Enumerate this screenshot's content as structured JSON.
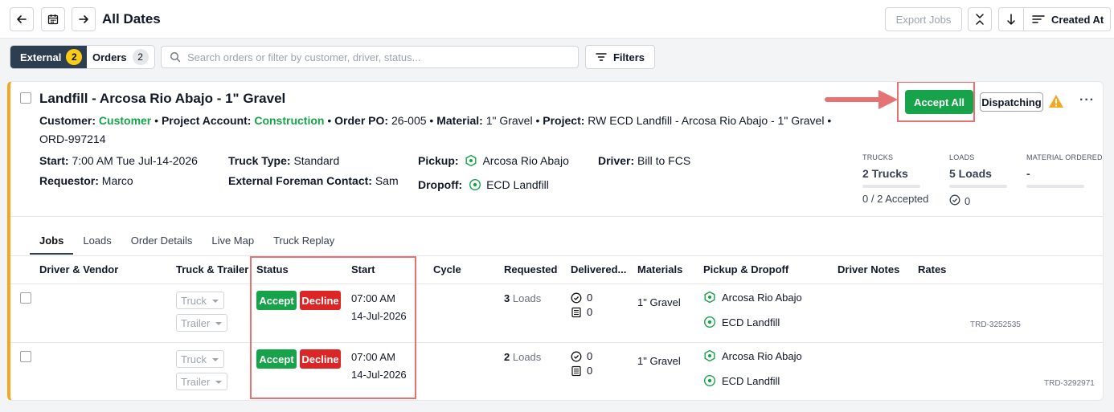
{
  "header": {
    "title": "All Dates",
    "export_label": "Export Jobs",
    "sort_label": "Created At"
  },
  "toolbar": {
    "segments": [
      {
        "label": "External",
        "count": "2"
      },
      {
        "label": "Orders",
        "count": "2"
      }
    ],
    "search_placeholder": "Search orders or filter by customer, driver, status...",
    "filters_label": "Filters"
  },
  "order": {
    "title": "Landfill - Arcosa Rio Abajo - 1\" Gravel",
    "customer_label": "Customer:",
    "customer": "Customer",
    "project_account_label": "Project Account:",
    "project_account": "Construction",
    "po_label": "Order PO:",
    "po": "26-005",
    "material_label": "Material:",
    "material": "1\" Gravel",
    "project_label": "Project:",
    "project": "RW ECD Landfill - Arcosa Rio Abajo - 1\" Gravel",
    "order_id": "ORD-997214",
    "start_label": "Start:",
    "start": "7:00 AM Tue Jul-14-2026",
    "requestor_label": "Requestor:",
    "requestor": "Marco",
    "truck_type_label": "Truck Type:",
    "truck_type": "Standard",
    "foreman_label": "External Foreman Contact:",
    "foreman": "Sam",
    "pickup_label": "Pickup:",
    "pickup": "Arcosa Rio Abajo",
    "dropoff_label": "Dropoff:",
    "dropoff": "ECD Landfill",
    "driver_label": "Driver:",
    "driver": "Bill to FCS",
    "accept_all_label": "Accept All",
    "dispatching_label": "Dispatching",
    "more_label": "···"
  },
  "stats": {
    "trucks_header": "TRUCKS",
    "trucks_value": "2 Trucks",
    "trucks_sub": "0 / 2 Accepted",
    "loads_header": "LOADS",
    "loads_value": "5 Loads",
    "loads_sub": "0",
    "material_header": "MATERIAL ORDERED",
    "material_value": "-"
  },
  "tabs": [
    "Jobs",
    "Loads",
    "Order Details",
    "Live Map",
    "Truck Replay"
  ],
  "table": {
    "headers": [
      "Driver & Vendor",
      "Truck & Trailer",
      "Status",
      "Start",
      "Cycle",
      "Requested",
      "Delivered...",
      "Materials",
      "Pickup & Dropoff",
      "Driver Notes",
      "Rates"
    ],
    "rows": [
      {
        "truck_placeholder": "Truck",
        "trailer_placeholder": "Trailer",
        "accept": "Accept",
        "decline": "Decline",
        "start_time": "07:00 AM",
        "start_date": "14-Jul-2026",
        "requested_count": "3",
        "requested_unit": "Loads",
        "delivered_loads": "0",
        "delivered_tickets": "0",
        "material": "1\" Gravel",
        "pickup": "Arcosa Rio Abajo",
        "dropoff": "ECD Landfill",
        "ref": "TRD-3252535"
      },
      {
        "truck_placeholder": "Truck",
        "trailer_placeholder": "Trailer",
        "accept": "Accept",
        "decline": "Decline",
        "start_time": "07:00 AM",
        "start_date": "14-Jul-2026",
        "requested_count": "2",
        "requested_unit": "Loads",
        "delivered_loads": "0",
        "delivered_tickets": "0",
        "material": "1\" Gravel",
        "pickup": "Arcosa Rio Abajo",
        "dropoff": "ECD Landfill",
        "ref": "TRD-3292971"
      }
    ]
  },
  "colors": {
    "accent": "#16a34a",
    "danger": "#dc2626",
    "warning": "#f5a623",
    "dark": "#2d3e50",
    "annotation": "#e57373"
  }
}
